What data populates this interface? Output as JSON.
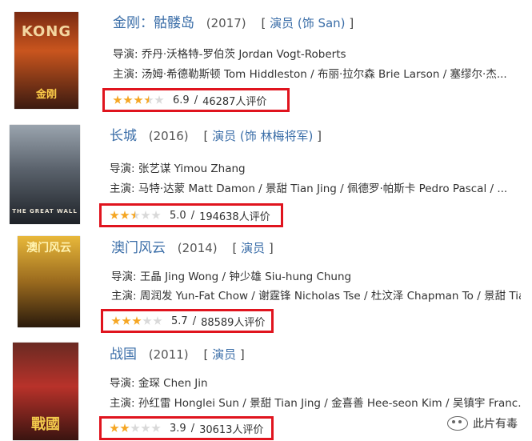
{
  "movies": [
    {
      "title": "金刚：骷髅岛",
      "year": "(2017)",
      "role": "演员 (饰 San)",
      "director_label": "导演:",
      "director": "乔丹·沃格特-罗伯茨 Jordan Vogt-Roberts",
      "cast_label": "主演:",
      "cast": "汤姆·希德勒斯顿 Tom Hiddleston / 布丽·拉尔森 Brie Larson / 塞缪尔·杰...",
      "stars": 3.5,
      "score": "6.9",
      "sep": "/",
      "votes": "46287人评价",
      "poster_text": "KONG",
      "poster_sub": "金刚",
      "poster_colors": [
        "#c9551e",
        "#3b1a10"
      ]
    },
    {
      "title": "长城",
      "year": "(2016)",
      "role": "演员 (饰 林梅将军)",
      "director_label": "导演:",
      "director": "张艺谋 Yimou Zhang",
      "cast_label": "主演:",
      "cast": "马特·达蒙 Matt Damon / 景甜 Tian Jing / 佩德罗·帕斯卡 Pedro Pascal / ...",
      "stars": 2.5,
      "score": "5.0",
      "sep": "/",
      "votes": "194638人评价",
      "poster_text": "THE GREAT WALL",
      "poster_sub": "",
      "poster_colors": [
        "#6a7480",
        "#1e2228"
      ]
    },
    {
      "title": "澳门风云",
      "year": "(2014)",
      "role": "演员",
      "director_label": "导演:",
      "director": "王晶 Jing Wong / 钟少雄 Siu-hung Chung",
      "cast_label": "主演:",
      "cast": "周润发 Yun-Fat Chow / 谢霆锋 Nicholas Tse / 杜汶泽 Chapman To / 景甜 Tia...",
      "stars": 3,
      "score": "5.7",
      "sep": "/",
      "votes": "88589人评价",
      "poster_text": "澳门风云",
      "poster_sub": "",
      "poster_colors": [
        "#d9a22a",
        "#2a1a0c"
      ]
    },
    {
      "title": "战国",
      "year": "(2011)",
      "role": "演员",
      "director_label": "导演:",
      "director": "金琛 Chen Jin",
      "cast_label": "主演:",
      "cast": "孙红雷 Honglei Sun / 景甜 Tian Jing / 金喜善 Hee-seon Kim / 吴镇宇 Franc...",
      "stars": 2,
      "score": "3.9",
      "sep": "/",
      "votes": "30613人评价",
      "poster_text": "戰國",
      "poster_sub": "",
      "poster_colors": [
        "#b8322a",
        "#3a1410"
      ]
    }
  ],
  "watermark": "此片有毒",
  "colors": {
    "star_on": "#f5a623",
    "star_off": "#d9d9d9",
    "highlight": "#e0141e",
    "link": "#3b6ea8"
  }
}
